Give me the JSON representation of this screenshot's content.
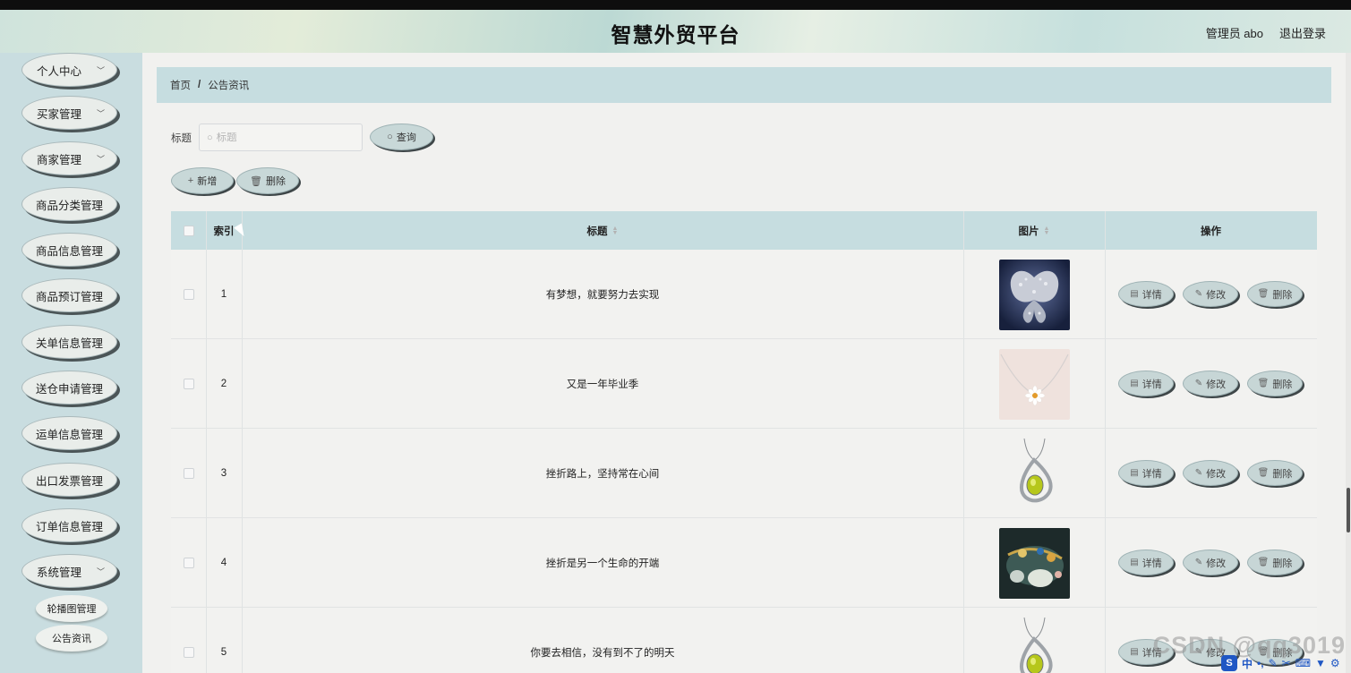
{
  "header": {
    "title": "智慧外贸平台",
    "user": "管理员 abo",
    "logout": "退出登录"
  },
  "sidebar": {
    "items": [
      {
        "label": "个人中心",
        "chevron": true
      },
      {
        "label": "买家管理",
        "chevron": true
      },
      {
        "label": "商家管理",
        "chevron": true
      },
      {
        "label": "商品分类管理",
        "chevron": false
      },
      {
        "label": "商品信息管理",
        "chevron": false
      },
      {
        "label": "商品预订管理",
        "chevron": false
      },
      {
        "label": "关单信息管理",
        "chevron": false
      },
      {
        "label": "送仓申请管理",
        "chevron": false
      },
      {
        "label": "运单信息管理",
        "chevron": false
      },
      {
        "label": "出口发票管理",
        "chevron": false
      },
      {
        "label": "订单信息管理",
        "chevron": false
      },
      {
        "label": "系统管理",
        "chevron": true
      }
    ],
    "subitems": [
      {
        "label": "轮播图管理"
      },
      {
        "label": "公告资讯"
      }
    ]
  },
  "breadcrumb": {
    "home": "首页",
    "separator": "/",
    "current": "公告资讯"
  },
  "search": {
    "label": "标题",
    "placeholder": "标题",
    "value": "",
    "button": "查询"
  },
  "actions": {
    "add": "新增",
    "delete": "删除"
  },
  "table": {
    "headers": {
      "index": "索引",
      "title": "标题",
      "image": "图片",
      "ops": "操作"
    },
    "rows": [
      {
        "index": "1",
        "title": "有梦想，就要努力去实现",
        "image_icon": "butterfly-brooch-image"
      },
      {
        "index": "2",
        "title": "又是一年毕业季",
        "image_icon": "daisy-necklace-image"
      },
      {
        "index": "3",
        "title": "挫折路上，坚持常在心间",
        "image_icon": "peridot-pendant-image"
      },
      {
        "index": "4",
        "title": "挫折是另一个生命的开端",
        "image_icon": "jade-brooch-image"
      },
      {
        "index": "5",
        "title": "你要去相信，没有到不了的明天",
        "image_icon": "peridot-pendant-image"
      }
    ],
    "op_labels": {
      "detail": "详情",
      "edit": "修改",
      "delete": "删除"
    }
  },
  "watermark": "CSDN @qq3019",
  "ime": {
    "mode": "中"
  },
  "colors": {
    "accent": "#c6dde0",
    "sidebar": "#c9dde0",
    "background": "#f1f1ef"
  }
}
